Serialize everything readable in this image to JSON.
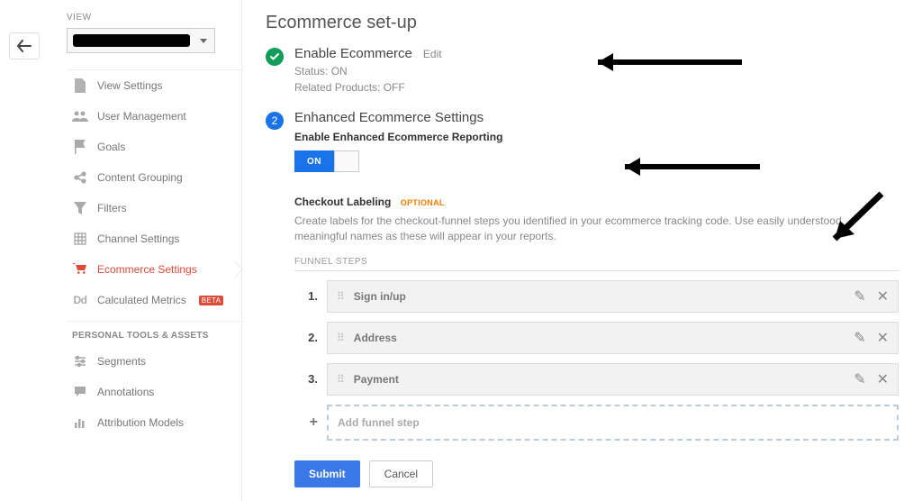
{
  "view_label": "VIEW",
  "sidebar_items": [
    {
      "id": "view-settings",
      "label": "View Settings"
    },
    {
      "id": "user-management",
      "label": "User Management"
    },
    {
      "id": "goals",
      "label": "Goals"
    },
    {
      "id": "content-grouping",
      "label": "Content Grouping"
    },
    {
      "id": "filters",
      "label": "Filters"
    },
    {
      "id": "channel-settings",
      "label": "Channel Settings"
    },
    {
      "id": "ecommerce-settings",
      "label": "Ecommerce Settings"
    },
    {
      "id": "calculated-metrics",
      "label": "Calculated Metrics",
      "badge": "BETA"
    }
  ],
  "tools_head": "PERSONAL TOOLS & ASSETS",
  "tool_items": [
    {
      "id": "segments",
      "label": "Segments"
    },
    {
      "id": "annotations",
      "label": "Annotations"
    },
    {
      "id": "attribution-models",
      "label": "Attribution Models"
    }
  ],
  "page_title": "Ecommerce set-up",
  "step1": {
    "title": "Enable Ecommerce",
    "edit": "Edit",
    "status": "Status: ON",
    "related": "Related Products: OFF"
  },
  "step2": {
    "num": "2",
    "title": "Enhanced Ecommerce Settings",
    "enable": "Enable Enhanced Ecommerce Reporting",
    "toggle": "ON"
  },
  "checkout": {
    "label": "Checkout Labeling",
    "opt": "OPTIONAL",
    "desc": "Create labels for the checkout-funnel steps you identified in your ecommerce tracking code. Use easily understood, meaningful names as these will appear in your reports.",
    "head": "FUNNEL STEPS",
    "steps": [
      {
        "n": "1.",
        "label": "Sign in/up"
      },
      {
        "n": "2.",
        "label": "Address"
      },
      {
        "n": "3.",
        "label": "Payment"
      }
    ],
    "add": "Add funnel step",
    "plus": "+"
  },
  "buttons": {
    "submit": "Submit",
    "cancel": "Cancel"
  }
}
